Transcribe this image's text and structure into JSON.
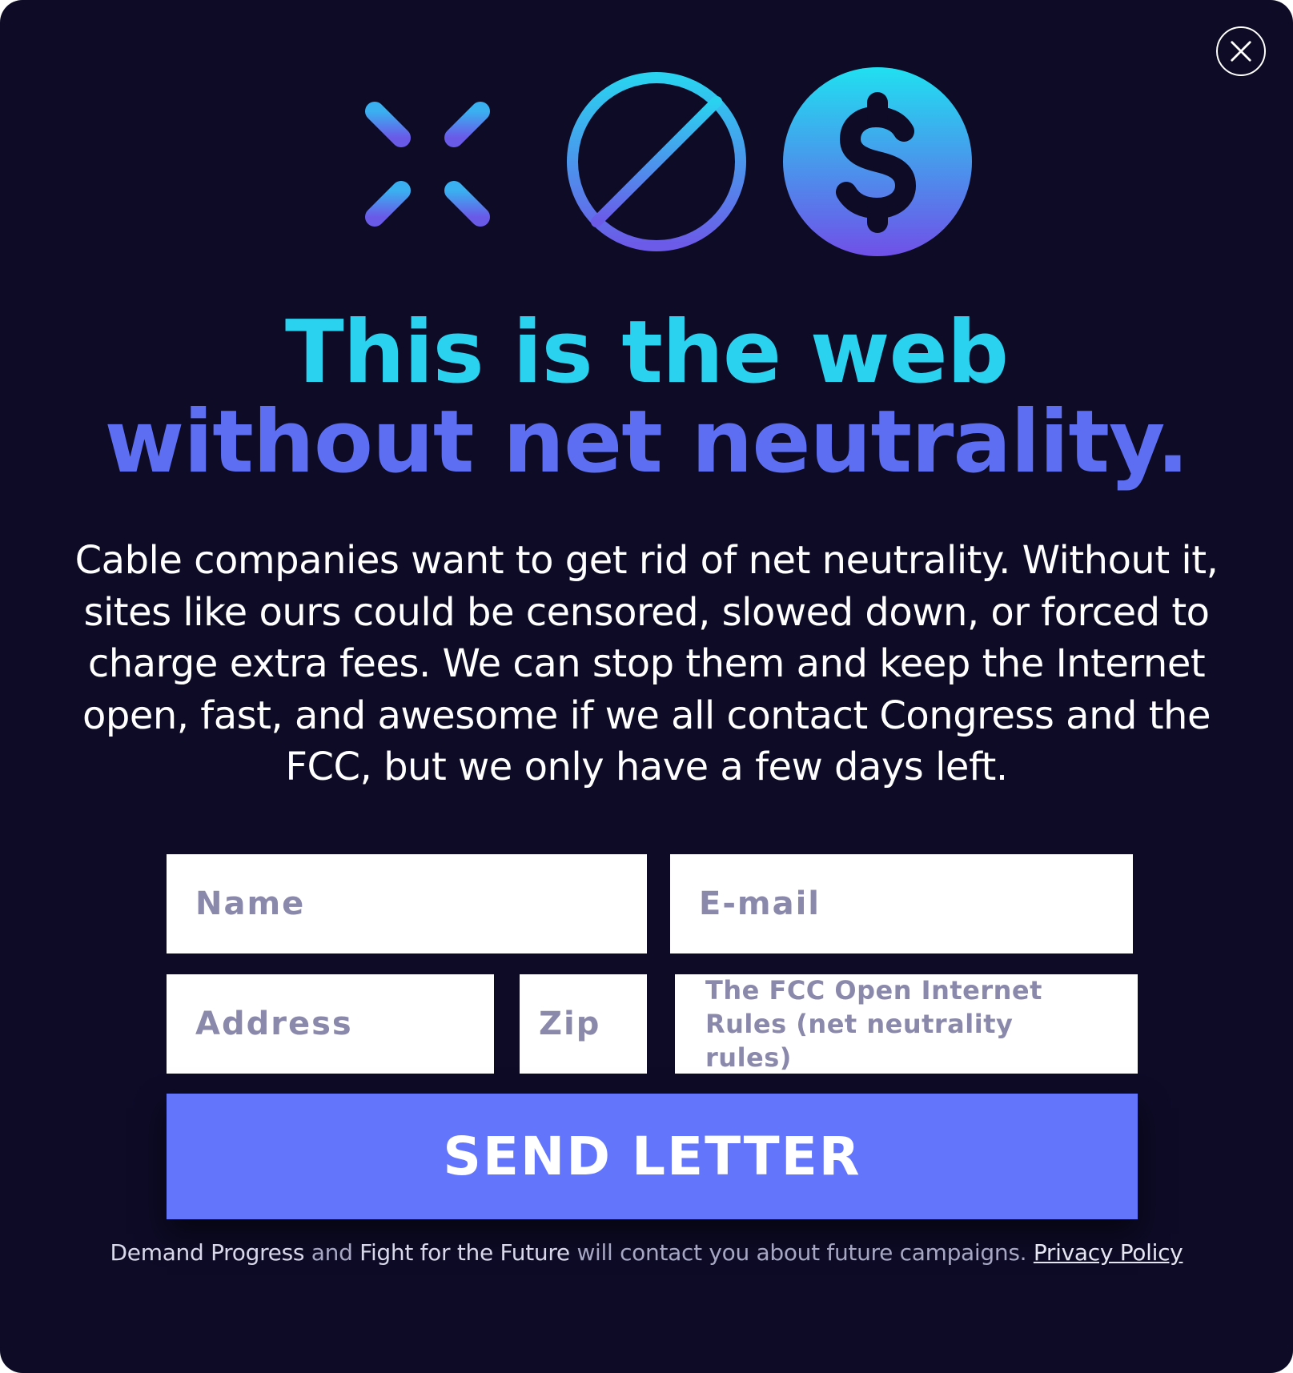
{
  "colors": {
    "background": "#0d0b26",
    "headline_cyan": "#2ad2f0",
    "headline_blue": "#5d6ef3",
    "button": "#6375fb",
    "placeholder": "#8a88ab"
  },
  "icons": {
    "close": "close-icon",
    "first": "loading-spinner-icon",
    "second": "blocked-icon",
    "third": "dollar-coin-icon"
  },
  "headline": {
    "line1": "This is the web",
    "line2": "without net neutrality."
  },
  "body_text": "Cable companies want to get rid of net neutrality. Without it, sites like ours could be censored, slowed down, or forced to charge extra fees. We can stop them and keep the Internet open, fast, and awesome if we all contact Congress and the FCC, but we only have a few days left.",
  "form": {
    "name_placeholder": "Name",
    "email_placeholder": "E-mail",
    "address_placeholder": "Address",
    "zip_placeholder": "Zip",
    "comment_text": "The FCC Open Internet Rules (net neutrality rules)",
    "submit_label": "SEND LETTER"
  },
  "footer": {
    "org1": "Demand Progress",
    "and": "and",
    "org2": "Fight for the Future",
    "middle": "will contact you about future campaigns.",
    "privacy_link": "Privacy Policy"
  }
}
